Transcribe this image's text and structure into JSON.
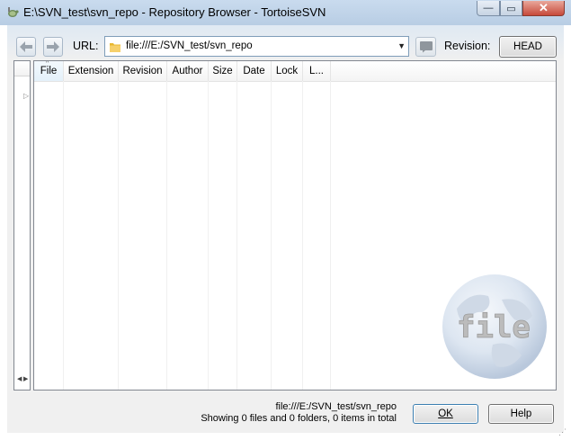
{
  "window": {
    "title": "E:\\SVN_test\\svn_repo - Repository Browser - TortoiseSVN",
    "minimize_glyph": "—",
    "maximize_glyph": "▭",
    "close_glyph": "✕"
  },
  "toolbar": {
    "url_label": "URL:",
    "url_value": "file:///E:/SVN_test/svn_repo",
    "revision_label": "Revision:",
    "head_button": "HEAD",
    "icons": [
      "back-arrow-icon",
      "forward-arrow-icon",
      "folder-icon",
      "dropdown-arrow-icon",
      "log-icon"
    ]
  },
  "list": {
    "columns": [
      "File",
      "Extension",
      "Revision",
      "Author",
      "Size",
      "Date",
      "Lock",
      "L..."
    ],
    "sorted_column": "File",
    "rows": []
  },
  "watermark": {
    "text": "file"
  },
  "status": {
    "url": "file:///E:/SVN_test/svn_repo",
    "summary": "Showing 0 files and 0 folders, 0 items in total"
  },
  "buttons": {
    "ok": "OK",
    "help": "Help"
  },
  "colors": {
    "titlebar": "#c9dbee",
    "close_button": "#c7493a",
    "dialog_bg": "#f0f0f0",
    "ok_border": "#3c7fb1"
  }
}
